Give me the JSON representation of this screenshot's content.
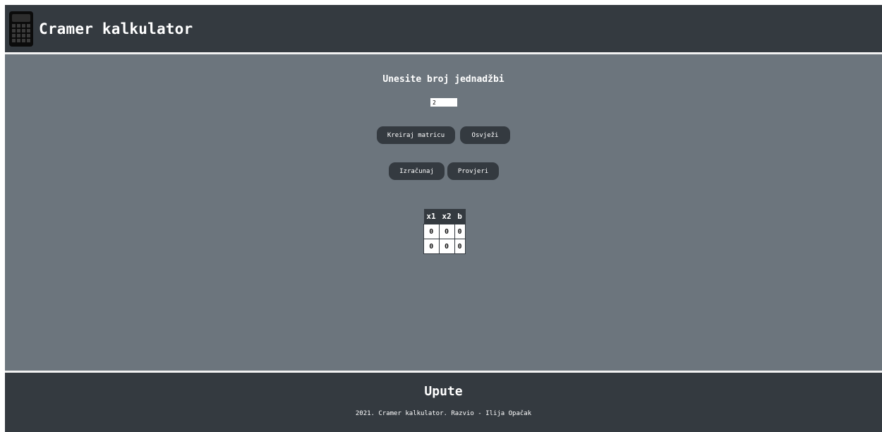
{
  "header": {
    "logo_icon": "calculator-icon",
    "title": "Cramer kalkulator"
  },
  "main": {
    "prompt": "Unesite broj jednadžbi",
    "equation_count": "2",
    "buttons": {
      "create": "Kreiraj matricu",
      "refresh": "Osvježi",
      "calculate": "Izračunaj",
      "check": "Provjeri"
    },
    "matrix": {
      "headers": [
        "x1",
        "x2",
        "b"
      ],
      "rows": [
        [
          "0",
          "0",
          "0"
        ],
        [
          "0",
          "0",
          "0"
        ]
      ]
    }
  },
  "footer": {
    "title": "Upute",
    "note": "2021. Cramer kalkulator. Razvio - Ilija Opačak"
  },
  "colors": {
    "dark": "#343a40",
    "panel": "#6c757d",
    "text": "#ffffff"
  }
}
